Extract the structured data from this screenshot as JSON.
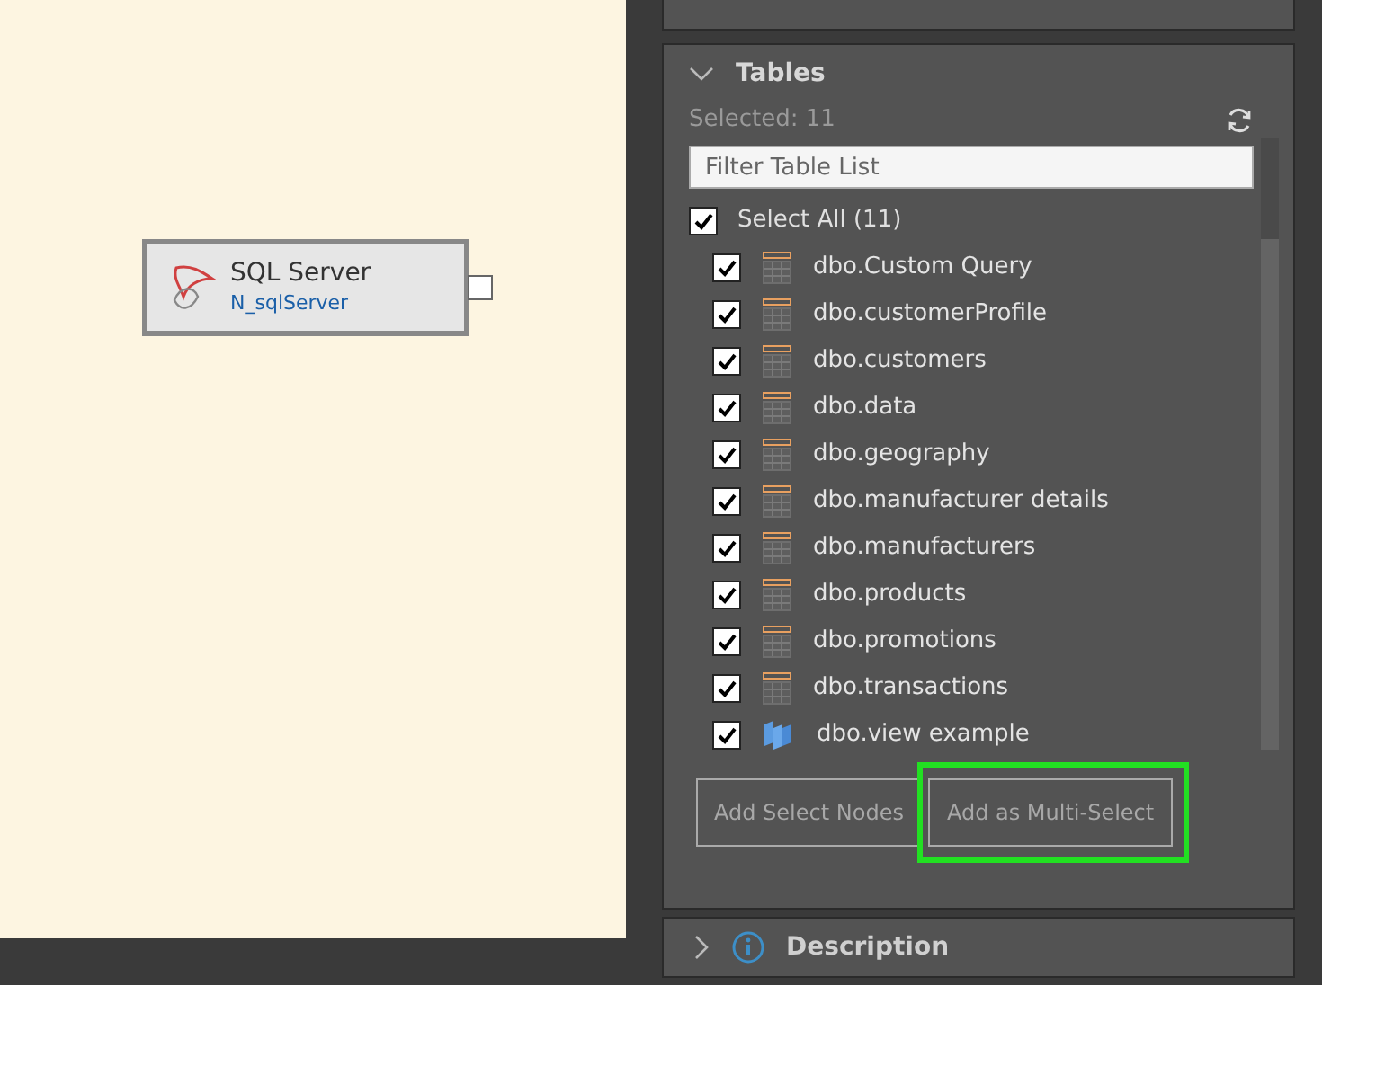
{
  "canvas": {
    "node": {
      "title": "SQL Server",
      "subtitle": "N_sqlServer"
    }
  },
  "tables_section": {
    "title": "Tables",
    "expanded": true,
    "selected_count": "Selected: 11",
    "filter": {
      "placeholder": "Filter Table List"
    },
    "select_all": {
      "label": "Select All (11)",
      "checked": true
    },
    "items": [
      {
        "label": "dbo.Custom Query",
        "kind": "table",
        "checked": true
      },
      {
        "label": "dbo.customerProfile",
        "kind": "table",
        "checked": true
      },
      {
        "label": "dbo.customers",
        "kind": "table",
        "checked": true
      },
      {
        "label": "dbo.data",
        "kind": "table",
        "checked": true
      },
      {
        "label": "dbo.geography",
        "kind": "table",
        "checked": true
      },
      {
        "label": "dbo.manufacturer details",
        "kind": "table",
        "checked": true
      },
      {
        "label": "dbo.manufacturers",
        "kind": "table",
        "checked": true
      },
      {
        "label": "dbo.products",
        "kind": "table",
        "checked": true
      },
      {
        "label": "dbo.promotions",
        "kind": "table",
        "checked": true
      },
      {
        "label": "dbo.transactions",
        "kind": "table",
        "checked": true
      },
      {
        "label": "dbo.view example",
        "kind": "view",
        "checked": true
      }
    ],
    "buttons": [
      {
        "label": "Add Select Nodes",
        "highlighted": false
      },
      {
        "label": "Add as Multi-Select",
        "highlighted": true
      }
    ]
  },
  "description_section": {
    "title": "Description",
    "expanded": false
  }
}
